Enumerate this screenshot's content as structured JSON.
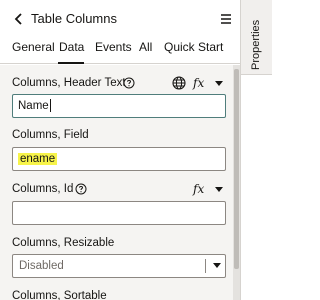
{
  "header": {
    "back_icon": "chevron-left-icon",
    "title": "Table Columns",
    "menu_icon": "hamburger-menu-icon"
  },
  "tabs": [
    {
      "label": "General"
    },
    {
      "label": "Data"
    },
    {
      "label": "Events"
    },
    {
      "label": "All"
    },
    {
      "label": "Quick Start"
    }
  ],
  "active_tab": "Data",
  "fields": {
    "header_text": {
      "label": "Columns, Header Text",
      "value": "Name",
      "icons": [
        "help-icon",
        "globe-icon",
        "fx-icon",
        "caret-down-icon"
      ]
    },
    "field": {
      "label": "Columns, Field",
      "value": "ename",
      "highlight_color": "#f7f44a"
    },
    "id": {
      "label": "Columns, Id",
      "value": "",
      "icons": [
        "help-icon",
        "fx-icon",
        "caret-down-icon"
      ]
    },
    "resizable": {
      "label": "Columns, Resizable",
      "value": "Disabled"
    },
    "sortable": {
      "label": "Columns, Sortable"
    }
  },
  "fx_label": "fx",
  "side_panel": {
    "label": "Properties"
  }
}
